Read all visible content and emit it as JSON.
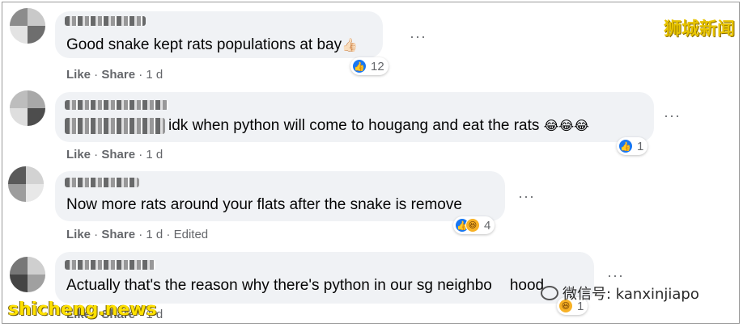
{
  "watermarks": {
    "top_right": "狮城新闻",
    "bottom_left": "shicheng.news",
    "wechat": "微信号: kanxinjiapo"
  },
  "colors": {
    "bubble": "#f0f2f5",
    "like_blue": "#1877f2",
    "meta_gray": "#65676b",
    "watermark_yellow": "#e8c400"
  },
  "comments": [
    {
      "text": "Good snake kept rats populations at bay",
      "emoji": "👍🏻",
      "reactions": {
        "icons": [
          "like-icon"
        ],
        "count": "12"
      },
      "actions": {
        "like": "Like",
        "share": "Share",
        "time": "1 d",
        "edited": ""
      }
    },
    {
      "text": "idk when python will come to hougang and eat the rats",
      "emoji": "😂😂😂",
      "reactions": {
        "icons": [
          "like-icon"
        ],
        "count": "1"
      },
      "actions": {
        "like": "Like",
        "share": "Share",
        "time": "1 d",
        "edited": ""
      }
    },
    {
      "text": "Now more rats around your flats after the snake is remove",
      "emoji": "",
      "reactions": {
        "icons": [
          "like-icon",
          "haha-icon"
        ],
        "count": "4"
      },
      "actions": {
        "like": "Like",
        "share": "Share",
        "time": "1 d",
        "edited": "Edited"
      }
    },
    {
      "text": "Actually that's the reason why there's python in our sg neighbo",
      "text_tail": "hood",
      "emoji": "",
      "reactions": {
        "icons": [
          "haha-icon"
        ],
        "count": "1"
      },
      "actions": {
        "like": "Like",
        "share": "Share",
        "time": "1 d",
        "edited": ""
      }
    }
  ],
  "separator": " · ",
  "more_menu": "···"
}
